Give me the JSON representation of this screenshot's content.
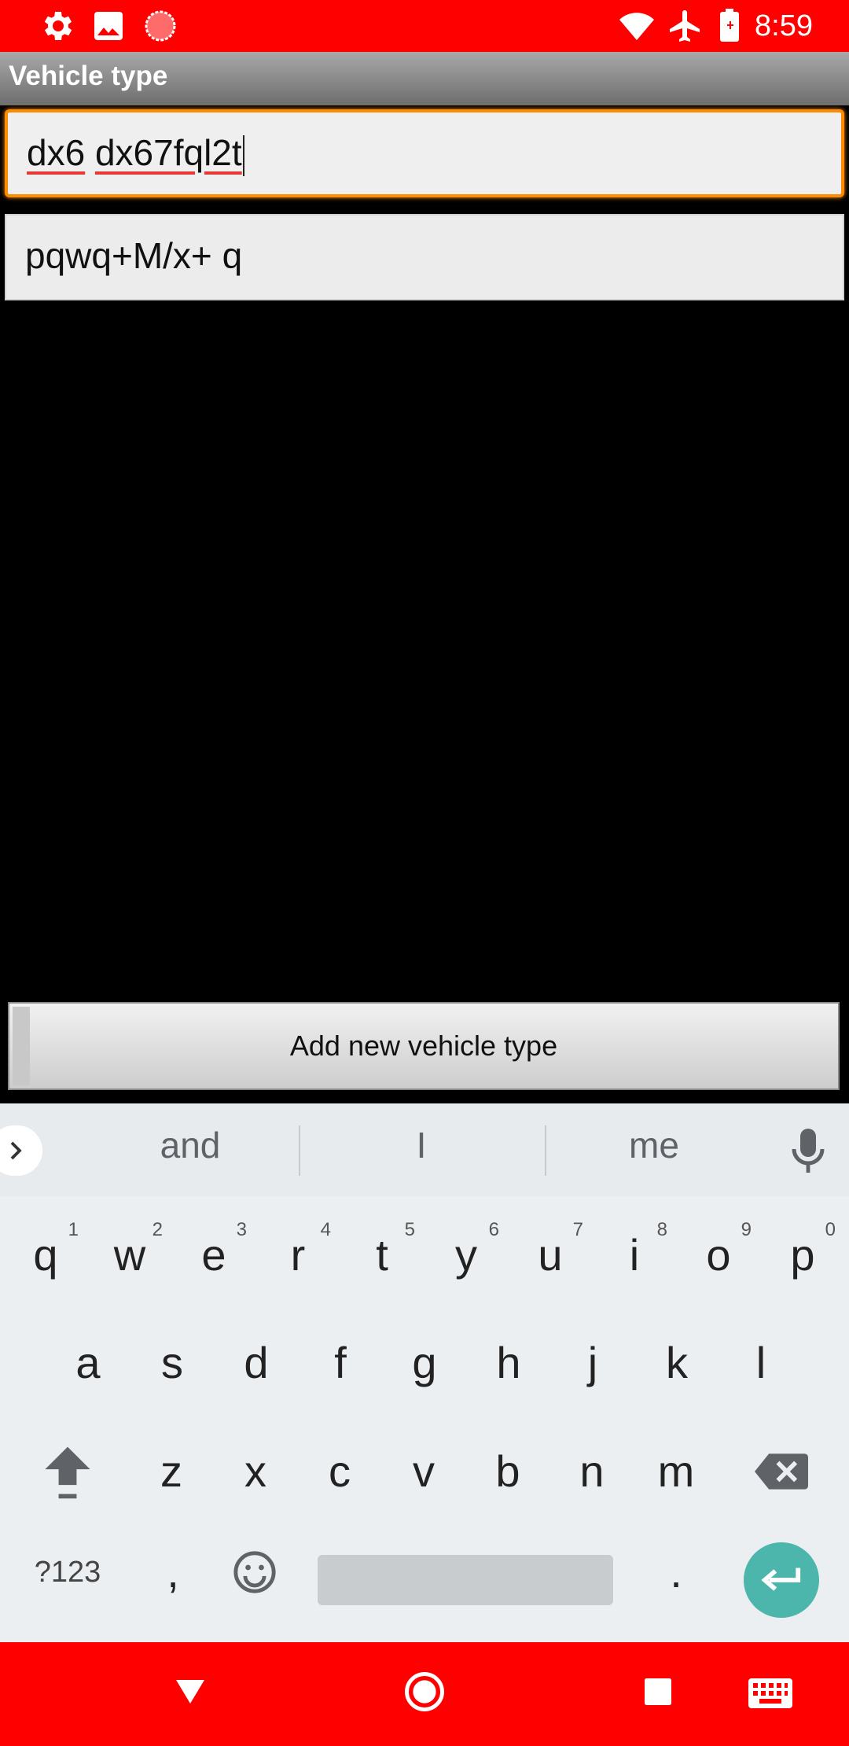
{
  "status_bar": {
    "time": "8:59",
    "left_icons": [
      "settings-icon",
      "image-icon",
      "record-icon"
    ],
    "right_icons": [
      "wifi-icon",
      "airplane-mode-icon",
      "battery-charging-icon"
    ],
    "color": "#ff0000"
  },
  "app": {
    "title": "Vehicle type"
  },
  "fields": {
    "name": {
      "value_word1": "dx6",
      "value_space": " ",
      "value_word2": "dx67fql2t",
      "focused": true
    },
    "description": {
      "value": "pqwq+M/x+ q"
    }
  },
  "add_button": {
    "label": "Add new vehicle type"
  },
  "keyboard": {
    "suggestions": [
      "and",
      "I",
      "me"
    ],
    "row1": [
      {
        "k": "q",
        "n": "1"
      },
      {
        "k": "w",
        "n": "2"
      },
      {
        "k": "e",
        "n": "3"
      },
      {
        "k": "r",
        "n": "4"
      },
      {
        "k": "t",
        "n": "5"
      },
      {
        "k": "y",
        "n": "6"
      },
      {
        "k": "u",
        "n": "7"
      },
      {
        "k": "i",
        "n": "8"
      },
      {
        "k": "o",
        "n": "9"
      },
      {
        "k": "p",
        "n": "0"
      }
    ],
    "row2": [
      "a",
      "s",
      "d",
      "f",
      "g",
      "h",
      "j",
      "k",
      "l"
    ],
    "row3": [
      "z",
      "x",
      "c",
      "v",
      "b",
      "n",
      "m"
    ],
    "symbols_label": "?123",
    "comma": ",",
    "period": ".",
    "accent_color": "#4db6ac"
  },
  "nav_bar": {
    "icons": [
      "back-icon",
      "home-icon",
      "recents-icon",
      "keyboard-icon"
    ],
    "color": "#ff0000"
  }
}
